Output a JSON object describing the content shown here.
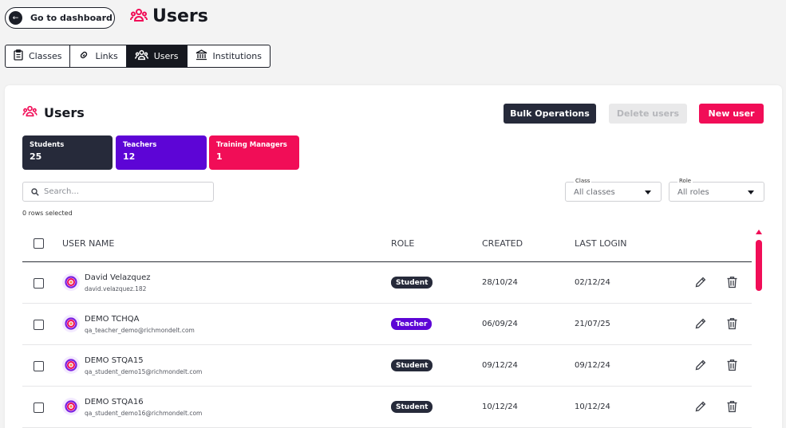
{
  "header": {
    "dashboard_button": "Go to dashboard",
    "title": "Users"
  },
  "tabs": [
    {
      "label": "Classes",
      "icon": "clipboard-icon",
      "active": false
    },
    {
      "label": "Links",
      "icon": "link-icon",
      "active": false
    },
    {
      "label": "Users",
      "icon": "users-icon",
      "active": true
    },
    {
      "label": "Institutions",
      "icon": "institution-icon",
      "active": false
    }
  ],
  "card": {
    "title": "Users",
    "buttons": {
      "bulk": "Bulk Operations",
      "delete": "Delete users",
      "new": "New user"
    },
    "stats": [
      {
        "title": "Students",
        "count": "25"
      },
      {
        "title": "Teachers",
        "count": "12"
      },
      {
        "title": "Training Managers",
        "count": "1"
      }
    ],
    "search": {
      "placeholder": "Search..."
    },
    "rows_selected": "0 rows selected",
    "filters": {
      "class": {
        "label": "Class",
        "value": "All classes"
      },
      "role": {
        "label": "Role",
        "value": "All roles"
      }
    }
  },
  "table": {
    "headers": {
      "name": "USER NAME",
      "role": "ROLE",
      "created": "CREATED",
      "last_login": "LAST LOGIN"
    },
    "rows": [
      {
        "name": "David Velazquez",
        "email": "david.velazquez.182",
        "role": "Student",
        "created": "28/10/24",
        "last_login": "02/12/24"
      },
      {
        "name": "DEMO TCHQA",
        "email": "qa_teacher_demo@richmondelt.com",
        "role": "Teacher",
        "created": "06/09/24",
        "last_login": "21/07/25"
      },
      {
        "name": "DEMO STQA15",
        "email": "qa_student_demo15@richmondelt.com",
        "role": "Student",
        "created": "09/12/24",
        "last_login": "09/12/24"
      },
      {
        "name": "DEMO STQA16",
        "email": "qa_student_demo16@richmondelt.com",
        "role": "Student",
        "created": "10/12/24",
        "last_login": "10/12/24"
      }
    ]
  },
  "colors": {
    "accent": "#f10d57",
    "dark": "#262a3a",
    "purple": "#5d05d6"
  }
}
